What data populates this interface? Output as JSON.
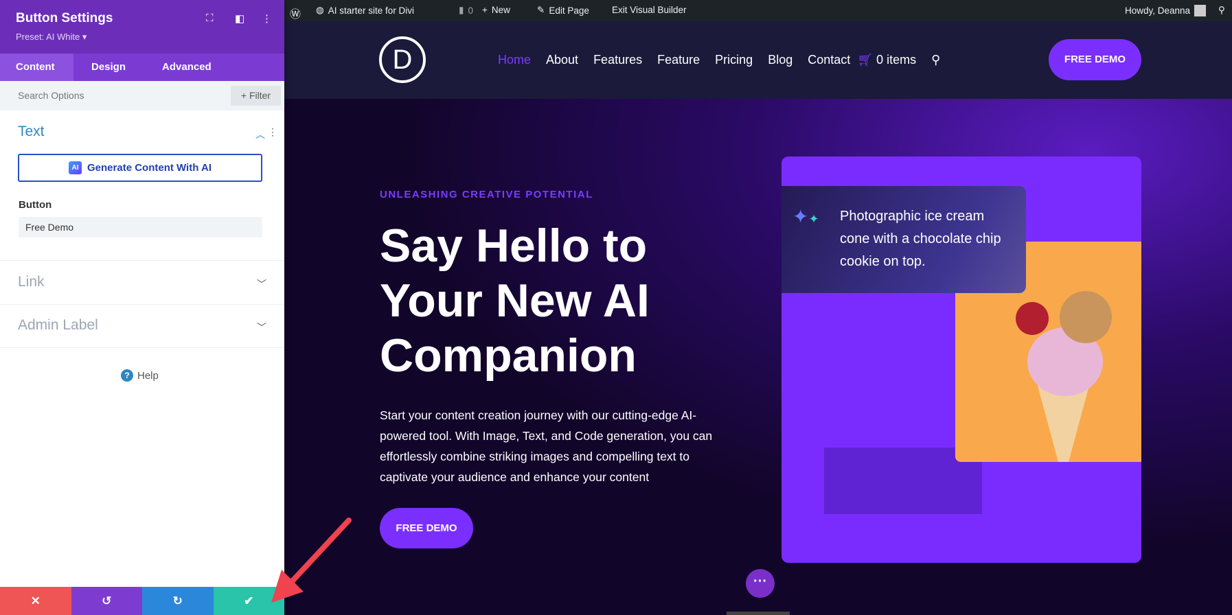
{
  "panel": {
    "title": "Button Settings",
    "preset": "Preset: AI White",
    "tabs": [
      "Content",
      "Design",
      "Advanced"
    ],
    "search_placeholder": "Search Options",
    "filter": "+ Filter",
    "sections": {
      "text": "Text",
      "link": "Link",
      "admin_label": "Admin Label"
    },
    "ai_button": "Generate Content With AI",
    "ai_icon_text": "AI",
    "button_label": "Button",
    "button_value": "Free Demo",
    "help": "Help",
    "bottom_colors": [
      "#ef5555",
      "#7e3bd0",
      "#2b87da",
      "#29c4a9"
    ]
  },
  "adminbar": {
    "site": "AI starter site for Divi",
    "comments": "0",
    "new": "New",
    "edit": "Edit Page",
    "exit": "Exit Visual Builder",
    "howdy": "Howdy, Deanna"
  },
  "header": {
    "logo": "D",
    "nav": [
      "Home",
      "About",
      "Features",
      "Feature",
      "Pricing",
      "Blog",
      "Contact"
    ],
    "cart": "0 items",
    "cta": "FREE DEMO"
  },
  "hero": {
    "kicker": "UNLEASHING CREATIVE POTENTIAL",
    "heading": "Say Hello to Your New AI Companion",
    "paragraph": "Start your content creation journey with our cutting-edge AI-powered tool. With Image, Text, and Code generation, you can effortlessly combine striking images and compelling text to captivate your audience and enhance your content",
    "cta": "FREE DEMO",
    "prompt": "Photographic ice cream cone with a chocolate chip cookie on top."
  },
  "colors": {
    "accent": "#7b2fff",
    "panel_header": "#6c2eb9"
  }
}
